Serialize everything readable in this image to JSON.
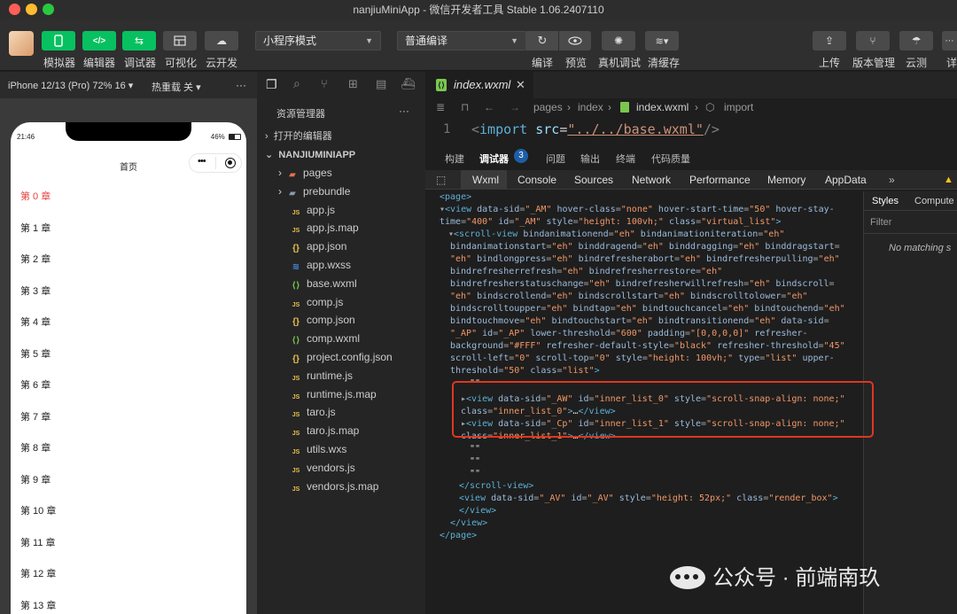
{
  "window": {
    "title": "nanjiuMiniApp - 微信开发者工具 Stable 1.06.2407110"
  },
  "toolbar": {
    "left_buttons": [
      "模拟器",
      "编辑器",
      "调试器",
      "可视化",
      "云开发"
    ],
    "mode_select": "小程序模式",
    "compile_select": "普通编译",
    "mid_buttons": [
      "编译",
      "预览",
      "真机调试",
      "清缓存"
    ],
    "right_buttons": [
      "上传",
      "版本管理",
      "云测",
      "详"
    ]
  },
  "simulator": {
    "device": "iPhone 12/13 (Pro) 72% 16 ▾",
    "hot_reload": "热重载 关 ▾",
    "more": "···",
    "status_time": "21:46",
    "status_battery": "46%",
    "nav_title": "首页",
    "capsule_dots": "•••",
    "chapters": [
      "第 0 章",
      "第 1 章",
      "第 2 章",
      "第 3 章",
      "第 4 章",
      "第 5 章",
      "第 6 章",
      "第 7 章",
      "第 8 章",
      "第 9 章",
      "第 10 章",
      "第 11 章",
      "第 12 章",
      "第 13 章"
    ],
    "active_color": "#e64340"
  },
  "explorer": {
    "title": "资源管理器",
    "more": "···",
    "open_editors": "打开的编辑器",
    "project": "NANJIUMINIAPP",
    "items": [
      {
        "name": "pages",
        "icon": "folder-icon",
        "color": "#e8704a"
      },
      {
        "name": "prebundle",
        "icon": "folder-icon",
        "color": "#8a9aa9"
      },
      {
        "name": "app.js",
        "icon": "js-icon",
        "color": "#e8c24a"
      },
      {
        "name": "app.js.map",
        "icon": "js-icon",
        "color": "#e8c24a"
      },
      {
        "name": "app.json",
        "icon": "json-icon",
        "color": "#e8c24a"
      },
      {
        "name": "app.wxss",
        "icon": "wxss-icon",
        "color": "#4a8ee8"
      },
      {
        "name": "base.wxml",
        "icon": "wxml-icon",
        "color": "#7ac74f"
      },
      {
        "name": "comp.js",
        "icon": "js-icon",
        "color": "#e8c24a"
      },
      {
        "name": "comp.json",
        "icon": "json-icon",
        "color": "#e8c24a"
      },
      {
        "name": "comp.wxml",
        "icon": "wxml-icon",
        "color": "#7ac74f"
      },
      {
        "name": "project.config.json",
        "icon": "json-icon",
        "color": "#e8c24a"
      },
      {
        "name": "runtime.js",
        "icon": "js-icon",
        "color": "#e8c24a"
      },
      {
        "name": "runtime.js.map",
        "icon": "js-icon",
        "color": "#e8c24a"
      },
      {
        "name": "taro.js",
        "icon": "js-icon",
        "color": "#e8c24a"
      },
      {
        "name": "taro.js.map",
        "icon": "js-icon",
        "color": "#e8c24a"
      },
      {
        "name": "utils.wxs",
        "icon": "js-icon",
        "color": "#e8c24a"
      },
      {
        "name": "vendors.js",
        "icon": "js-icon",
        "color": "#e8c24a"
      },
      {
        "name": "vendors.js.map",
        "icon": "js-icon",
        "color": "#e8c24a"
      }
    ]
  },
  "editor": {
    "tab": "index.wxml",
    "breadcrumb": [
      "pages",
      "index",
      "index.wxml",
      "import"
    ],
    "line_no": "1",
    "code": {
      "open": "<",
      "tag": "import",
      "attr": "src",
      "eq": "=",
      "value": "\"../../base.wxml\"",
      "close": "/>"
    }
  },
  "devtools": {
    "tabs": [
      "构建",
      "调试器",
      "问题",
      "输出",
      "终端",
      "代码质量"
    ],
    "badge": "3",
    "subtabs": [
      "Wxml",
      "Console",
      "Sources",
      "Network",
      "Performance",
      "Memory",
      "AppData"
    ],
    "styles_tabs": [
      "Styles",
      "Compute"
    ],
    "filter": "Filter",
    "no_match": "No matching s"
  },
  "watermark": "公众号 · 前端南玖"
}
